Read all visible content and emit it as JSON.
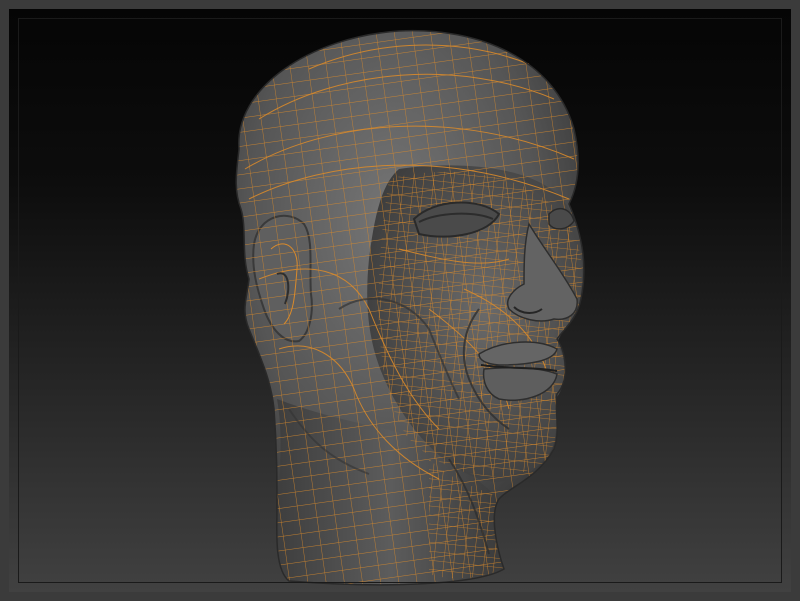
{
  "viewport": {
    "description_name": "3d-sculpt-viewport",
    "wireframe_color": "#d98a2b",
    "surface_color": "#5a5a5a",
    "background_top": "#050505",
    "background_bottom": "#414141",
    "frame_color": "#3b3b3b"
  }
}
